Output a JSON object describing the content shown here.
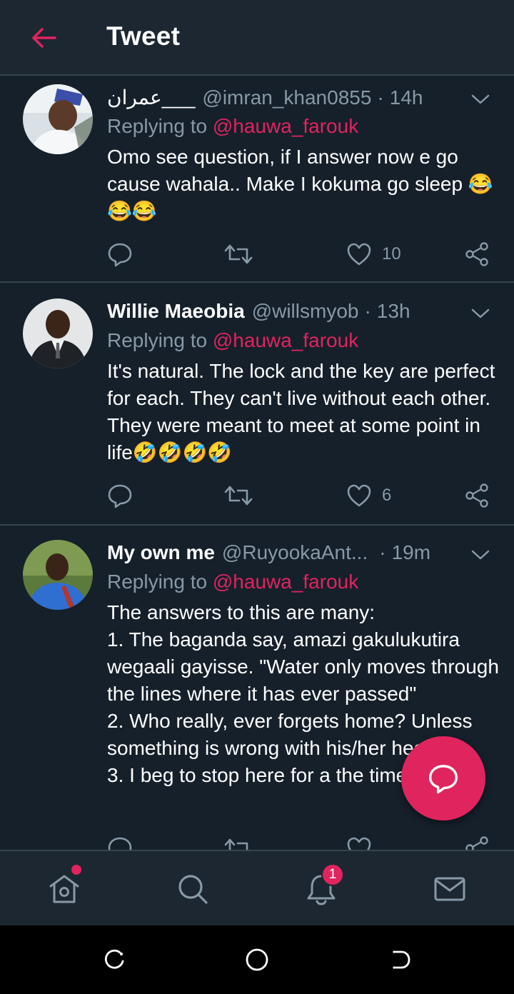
{
  "header": {
    "title": "Tweet",
    "back_icon": "arrow-left-icon",
    "accent": "#e0245e"
  },
  "tweets": [
    {
      "name": "عمران___",
      "handle": "@imran_khan0855",
      "time": "14h",
      "replying_label": "Replying to",
      "replying_to": "@hauwa_farouk",
      "text": "Omo see question, if I answer now e go cause wahala.. Make I kokuma go sleep 😂😂😂",
      "likes": "10",
      "retweets": "",
      "replies": ""
    },
    {
      "name": "Willie Maeobia",
      "handle": "@willsmyob",
      "time": "13h",
      "replying_label": "Replying to",
      "replying_to": "@hauwa_farouk",
      "text": "It's natural. The lock and the key are perfect for each. They can't live without each other. They were meant to meet at some point in life🤣🤣🤣🤣",
      "likes": "6",
      "retweets": "",
      "replies": ""
    },
    {
      "name": "My own me",
      "handle": "@RuyookaAnt...",
      "time": "19m",
      "replying_label": "Replying to",
      "replying_to": "@hauwa_farouk",
      "text": "The answers to this are many:\n1. The baganda say, amazi gakulukutira wegaali gayisse. \"Water only moves through the lines where it has ever passed\"\n2. Who really, ever forgets home? Unless something is wrong with his/her head\n3. I beg to stop here for a the time being.",
      "likes": "",
      "retweets": "",
      "replies": ""
    }
  ],
  "fab": {
    "icon": "compose-reply-icon"
  },
  "bottom_nav": {
    "items": [
      {
        "name": "home",
        "icon": "home-icon"
      },
      {
        "name": "search",
        "icon": "search-icon"
      },
      {
        "name": "notifications",
        "icon": "bell-icon",
        "badge": "1"
      },
      {
        "name": "messages",
        "icon": "mail-icon"
      }
    ]
  },
  "system_nav": {
    "items": [
      "recent-apps-icon",
      "home-circle-icon",
      "back-icon"
    ]
  }
}
